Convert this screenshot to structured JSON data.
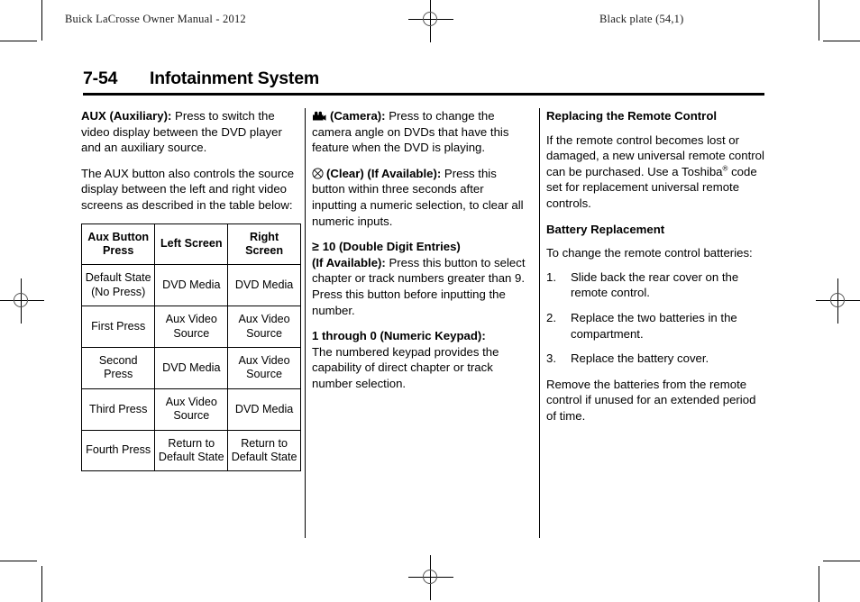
{
  "header": {
    "left": "Buick LaCrosse Owner Manual - 2012",
    "right": "Black plate (54,1)"
  },
  "page": {
    "folio": "7-54",
    "title": "Infotainment System"
  },
  "column_one": {
    "aux_term": "AUX (Auxiliary):",
    "aux_text": " Press to switch the video display between the DVD player and an auxiliary source.",
    "aux_paragraph_2": "The AUX button also controls the source display between the left and right video screens as described in the table below:",
    "table": {
      "headers": [
        "Aux Button Press",
        "Left Screen",
        "Right Screen"
      ],
      "rows": [
        [
          "Default State (No Press)",
          "DVD Media",
          "DVD Media"
        ],
        [
          "First Press",
          "Aux Video Source",
          "Aux Video Source"
        ],
        [
          "Second Press",
          "DVD Media",
          "Aux Video Source"
        ],
        [
          "Third Press",
          "Aux Video Source",
          "DVD Media"
        ],
        [
          "Fourth Press",
          "Return to Default State",
          "Return to Default State"
        ]
      ]
    }
  },
  "column_two": {
    "camera_term": "(Camera):",
    "camera_text": " Press to change the camera angle on DVDs that have this feature when the DVD is playing.",
    "clear_term": "(Clear) (If Available):",
    "clear_text": " Press this button within three seconds after inputting a numeric selection, to clear all numeric inputs.",
    "double_digit_symbol": "≥",
    "double_digit_term_line1": "10 (Double Digit Entries)",
    "double_digit_term_line2": "(If Available):",
    "double_digit_text": " Press this button to select chapter or track numbers greater than 9. Press this button before inputting the number.",
    "keypad_term": "1 through 0 (Numeric Keypad):",
    "keypad_text": "The numbered keypad provides the capability of direct chapter or track number selection."
  },
  "column_three": {
    "heading_replacing": "Replacing the Remote Control",
    "replacing_text_a": "If the remote control becomes lost or damaged, a new universal remote control can be purchased. Use a Toshiba",
    "replacing_trademark": "®",
    "replacing_text_b": " code set for replacement universal remote controls.",
    "heading_battery": "Battery Replacement",
    "battery_intro": "To change the remote control batteries:",
    "steps": [
      {
        "num": "1.",
        "text": "Slide back the rear cover on the remote control."
      },
      {
        "num": "2.",
        "text": "Replace the two batteries in the compartment."
      },
      {
        "num": "3.",
        "text": "Replace the battery cover."
      }
    ],
    "closing_text": "Remove the batteries from the remote control if unused for an extended period of time."
  },
  "icons": {
    "camera": "camera-icon",
    "clear": "clear-circle-x-icon",
    "registration": "registration-target-icon"
  },
  "colors": {
    "text": "#000000",
    "background": "#ffffff",
    "rule": "#000000"
  }
}
